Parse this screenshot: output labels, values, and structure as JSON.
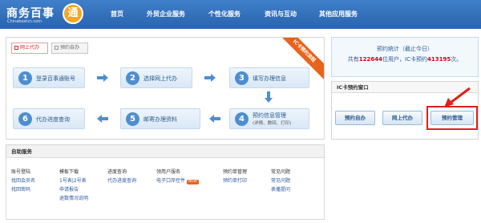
{
  "header": {
    "logo_text": "商务百事",
    "logo_mark": "通",
    "logo_sub": "Chinabestsn.com",
    "nav": [
      "首页",
      "外贸企业服务",
      "个性化服务",
      "资讯与互动",
      "其他应用服务"
    ]
  },
  "steps_panel": {
    "tabs": [
      "网上代办",
      "预约自办"
    ],
    "ribbon": "IC卡预约流程",
    "steps": [
      {
        "num": "1",
        "label": "登录百事通账号"
      },
      {
        "num": "2",
        "label": "选择网上代办"
      },
      {
        "num": "3",
        "label": "填写办理信息"
      },
      {
        "num": "4",
        "label": "预约信息管理",
        "sub": "(详情、数回、打印)"
      },
      {
        "num": "5",
        "label": "邮寄办理资料"
      },
      {
        "num": "6",
        "label": "代办进度查询"
      }
    ]
  },
  "self_service": {
    "title": "自助服务",
    "columns": [
      {
        "head": "账号登陆",
        "links": [
          "找回会员名",
          "找回密码"
        ]
      },
      {
        "head": "模板下载",
        "links": [
          "1号表|2号表",
          "申请报告",
          "退数情况说明"
        ]
      },
      {
        "head": "进度查询",
        "links": [
          "代办进度查询"
        ]
      },
      {
        "head": "领用户服务",
        "links": [
          "电子口岸控件"
        ],
        "badge": "NEW"
      },
      {
        "head": "预约单管理",
        "links": [
          "预约单打印"
        ]
      },
      {
        "head": "常见问题",
        "links": [
          "常见问题",
          "表播提问"
        ]
      }
    ]
  },
  "stats": {
    "line1": "预约统计（截止今日）",
    "prefix": "共有",
    "users": "122644",
    "mid": "位用户，IC卡预约",
    "count": "413195",
    "suffix": "次。"
  },
  "ic_window": {
    "title": "IC卡预约窗口",
    "buttons": [
      "预约自办",
      "网上代办",
      "预约管理"
    ]
  },
  "colors": {
    "accent": "#2a64ad",
    "highlight": "#e0201c",
    "ribbon": "#e8631c"
  }
}
